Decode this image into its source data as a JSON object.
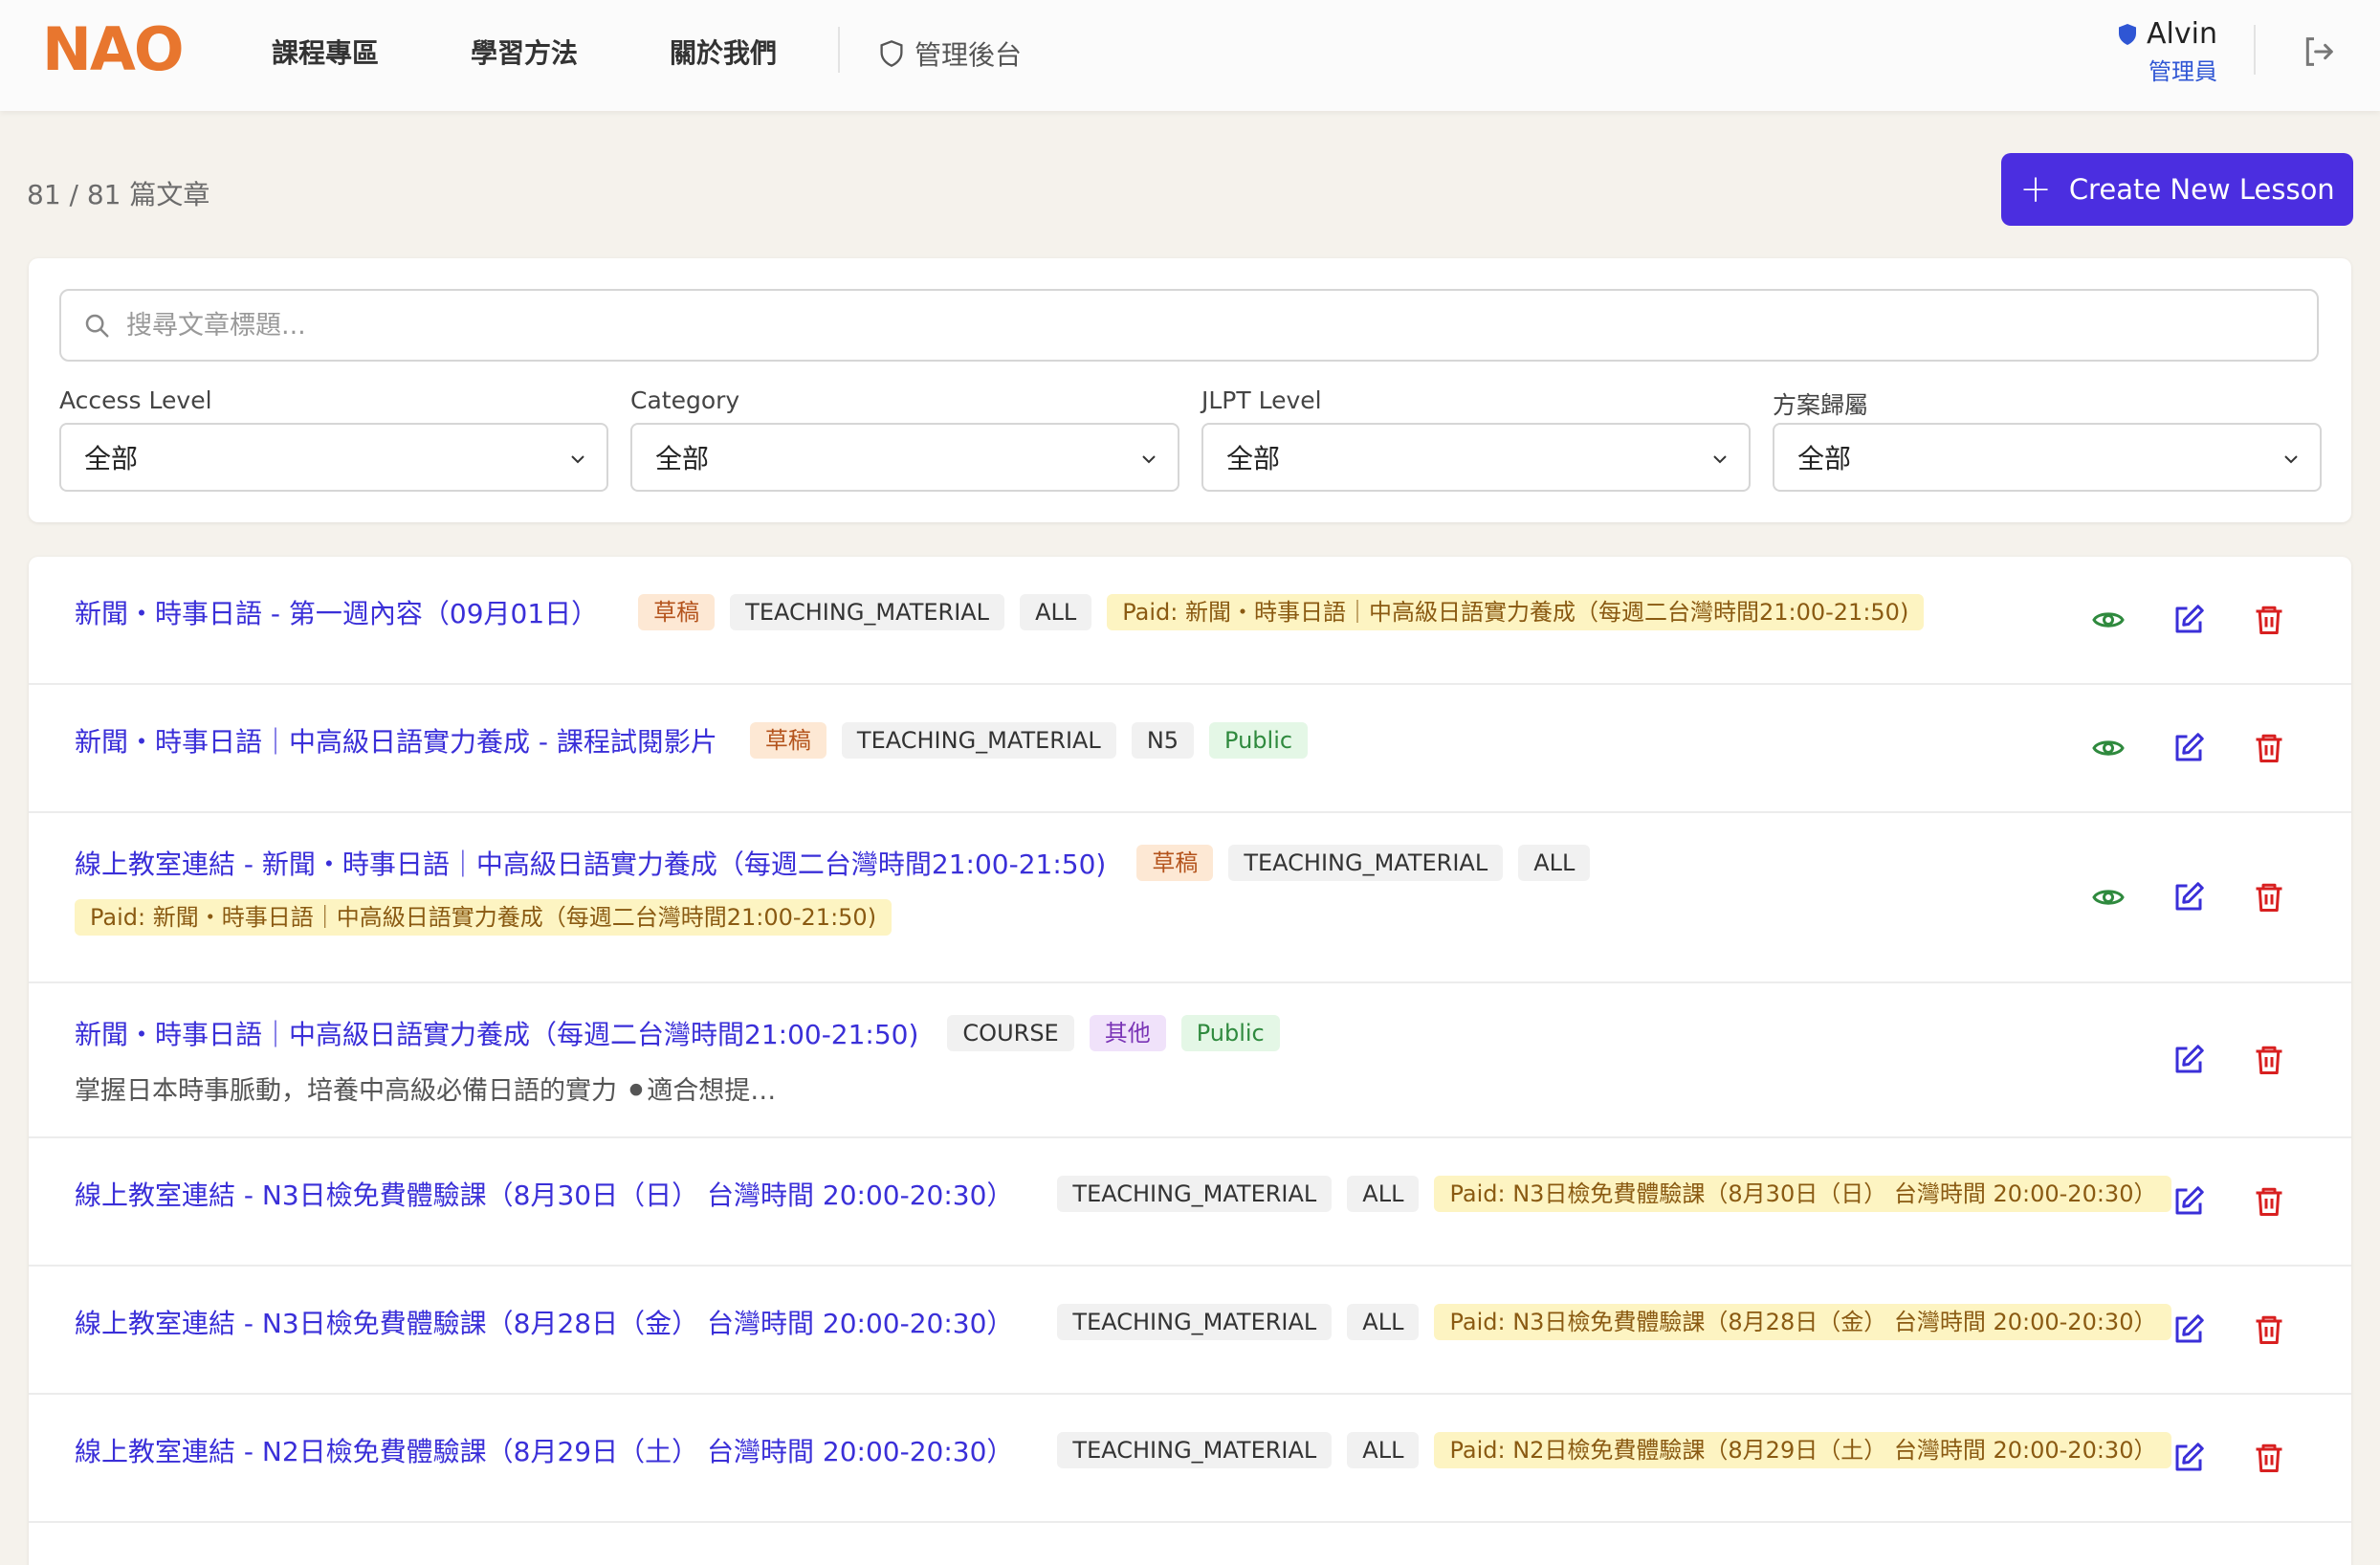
{
  "header": {
    "logo_text": "NAO",
    "nav": [
      "課程專區",
      "學習方法",
      "關於我們"
    ],
    "admin_link": "管理後台",
    "user_name": "Alvin",
    "user_role": "管理員"
  },
  "toolbar": {
    "count_text": "81 / 81 篇文章",
    "create_label": "Create New Lesson"
  },
  "filters": {
    "search_placeholder": "搜尋文章標題...",
    "access_label": "Access Level",
    "access_value": "全部",
    "category_label": "Category",
    "category_value": "全部",
    "jlpt_label": "JLPT Level",
    "jlpt_value": "全部",
    "plan_label": "方案歸屬",
    "plan_value": "全部"
  },
  "lessons": [
    {
      "title": "新聞・時事日語 - 第一週內容（09月01日）",
      "draft": "草稿",
      "category": "TEACHING_MATERIAL",
      "level": "ALL",
      "access": "Paid: 新聞・時事日語｜中高級日語實力養成（每週二台灣時間21:00-21:50)"
    },
    {
      "title": "新聞・時事日語｜中高級日語實力養成 - 課程試閱影片",
      "draft": "草稿",
      "category": "TEACHING_MATERIAL",
      "level": "N5",
      "access": "Public"
    },
    {
      "title": "線上教室連結 - 新聞・時事日語｜中高級日語實力養成（每週二台灣時間21:00-21:50)",
      "draft": "草稿",
      "category": "TEACHING_MATERIAL",
      "level": "ALL",
      "access": "Paid: 新聞・時事日語｜中高級日語實力養成（每週二台灣時間21:00-21:50)"
    },
    {
      "title": "新聞・時事日語｜中高級日語實力養成（每週二台灣時間21:00-21:50)",
      "category": "COURSE",
      "level": "其他",
      "access": "Public",
      "description": "掌握日本時事脈動，培養中高級必備日語的實力 ⚫適合想提…"
    },
    {
      "title": "線上教室連結 - N3日檢免費體驗課（8月30日（日） 台灣時間 20:00-20:30）",
      "category": "TEACHING_MATERIAL",
      "level": "ALL",
      "access": "Paid: N3日檢免費體驗課（8月30日（日） 台灣時間 20:00-20:30）"
    },
    {
      "title": "線上教室連結 - N3日檢免費體驗課（8月28日（金） 台灣時間 20:00-20:30）",
      "category": "TEACHING_MATERIAL",
      "level": "ALL",
      "access": "Paid: N3日檢免費體驗課（8月28日（金） 台灣時間 20:00-20:30）"
    },
    {
      "title": "線上教室連結 - N2日檢免費體驗課（8月29日（土） 台灣時間 20:00-20:30）",
      "category": "TEACHING_MATERIAL",
      "level": "ALL",
      "access": "Paid: N2日檢免費體驗課（8月29日（土） 台灣時間 20:00-20:30）"
    }
  ],
  "colors": {
    "brand": "#e8762e",
    "primary": "#4b2ee0",
    "link": "#3a2fd8",
    "view_icon": "#2f8a3e",
    "edit_icon": "#3a2fd8",
    "delete_icon": "#d82020"
  },
  "icons": {
    "admin": "shield-icon",
    "user": "shield-filled-icon",
    "logout": "logout-icon",
    "search": "search-icon",
    "select": "chevron-down-icon",
    "view": "eye-icon",
    "edit": "edit-icon",
    "delete": "trash-icon"
  }
}
